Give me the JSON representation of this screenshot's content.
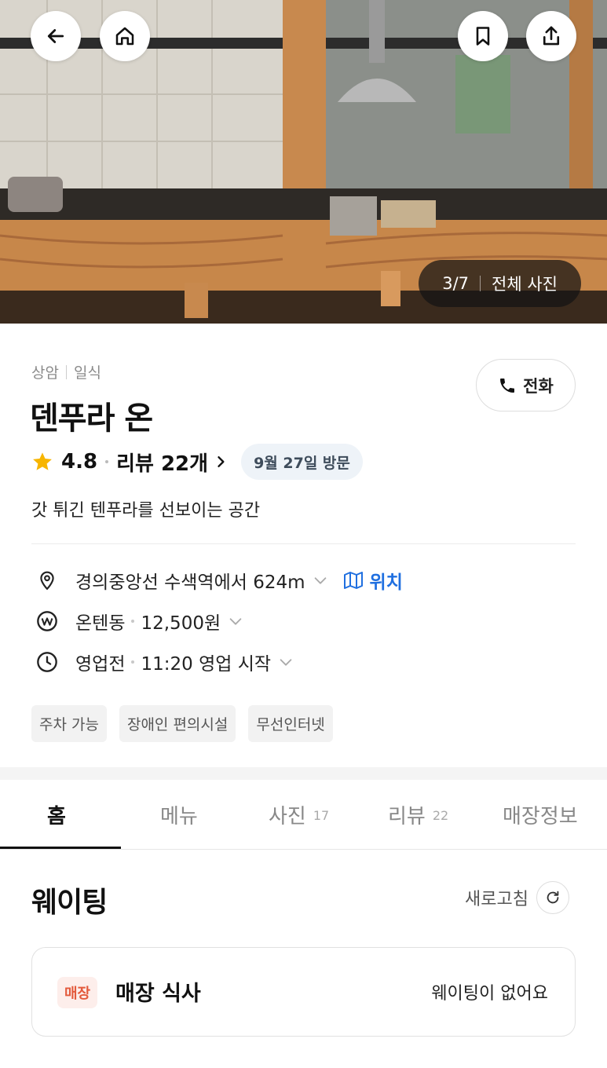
{
  "hero": {
    "counter_current": "3/7",
    "counter_all_label": "전체 사진"
  },
  "place": {
    "region": "상암",
    "category": "일식",
    "name": "덴푸라 온",
    "call_label": "전화",
    "rating": "4.8",
    "review_label": "리뷰 22개",
    "visit_chip": "9월 27일 방문",
    "description": "갓 튀긴 텐푸라를 선보이는 공간"
  },
  "info": {
    "location": "경의중앙선 수색역에서 624m",
    "location_link": "위치",
    "menu_name": "온텐동",
    "menu_price": "12,500원",
    "hours_status": "영업전",
    "hours_detail": "11:20 영업 시작"
  },
  "tags": [
    "주차 가능",
    "장애인 편의시설",
    "무선인터넷"
  ],
  "tabs": [
    {
      "label": "홈",
      "count": ""
    },
    {
      "label": "메뉴",
      "count": ""
    },
    {
      "label": "사진",
      "count": "17"
    },
    {
      "label": "리뷰",
      "count": "22"
    },
    {
      "label": "매장정보",
      "count": ""
    }
  ],
  "waiting": {
    "title": "웨이팅",
    "refresh_label": "새로고침",
    "badge": "매장",
    "type_label": "매장 식사",
    "status": "웨이팅이 없어요"
  },
  "colors": {
    "accent_link": "#1f6fe0",
    "star": "#f7b500",
    "badge_text": "#e35a3c",
    "badge_bg": "#fdeeeb"
  },
  "icons": [
    "back-arrow-icon",
    "home-icon",
    "bookmark-icon",
    "share-icon",
    "phone-icon",
    "star-icon",
    "chevron-right-icon",
    "location-pin-icon",
    "map-icon",
    "won-icon",
    "clock-icon",
    "chevron-down-icon",
    "refresh-icon"
  ]
}
